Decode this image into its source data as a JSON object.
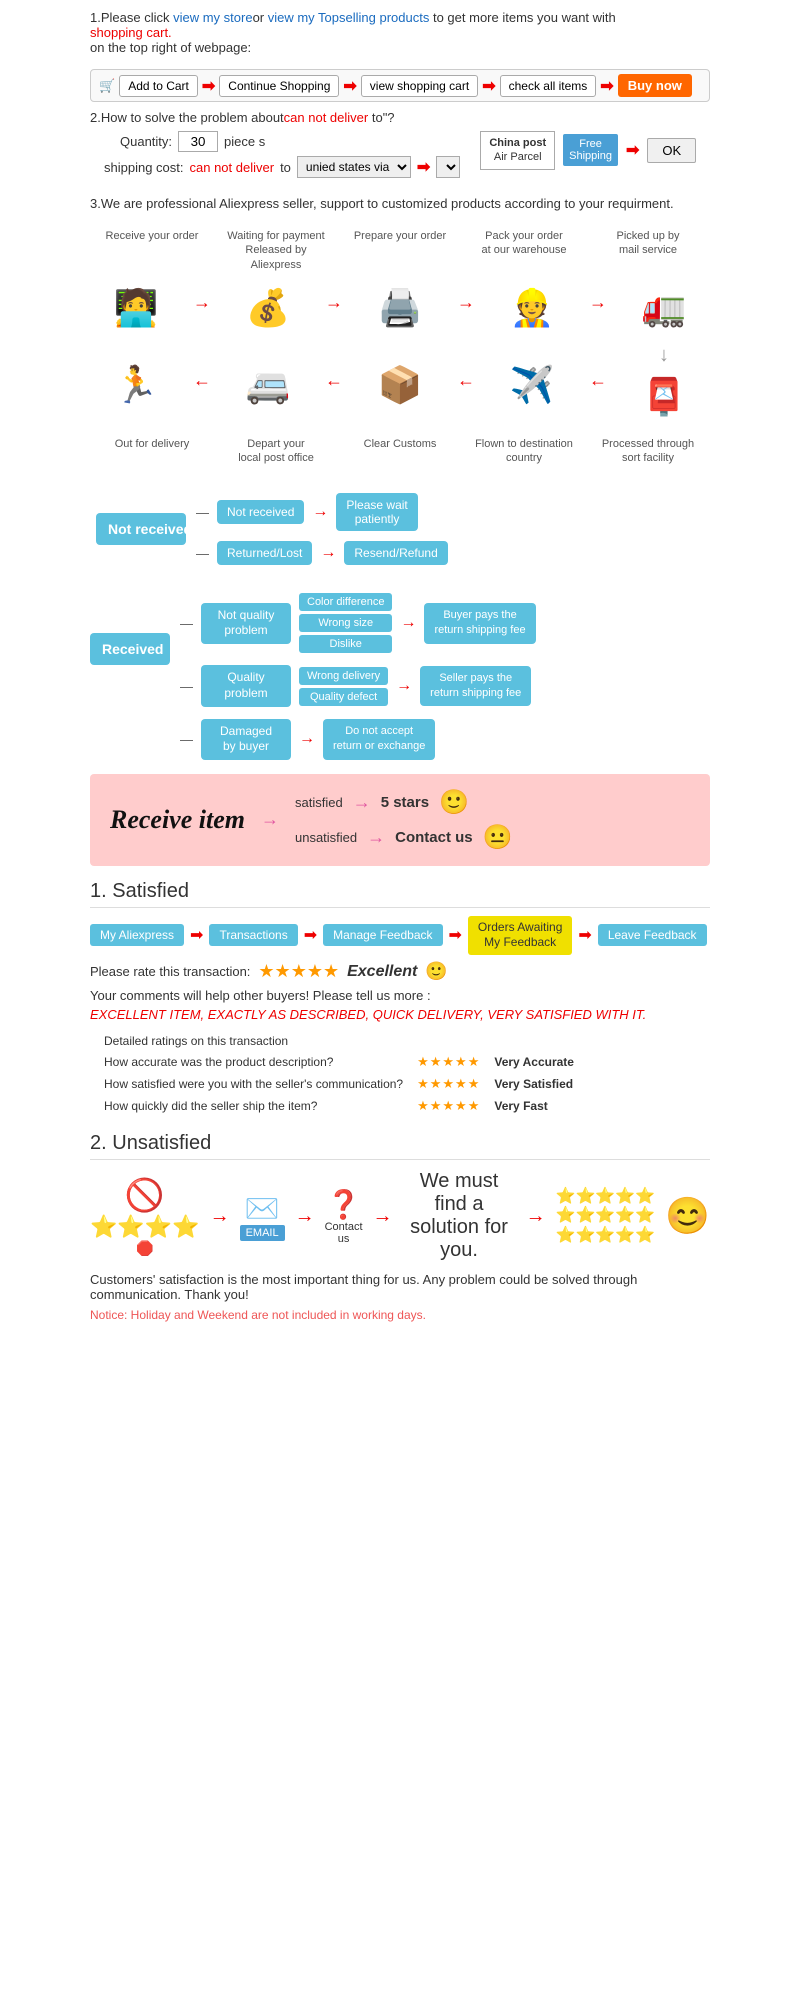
{
  "intro": {
    "line1_pre": "1.Please click ",
    "link1": "view my store",
    "line1_mid": "or ",
    "link2": "view my Topselling products",
    "line1_suf": " to get more items you want with",
    "line1b": "shopping cart.",
    "line2": "on the top right of webpage:"
  },
  "cart_bar": {
    "add": "Add to Cart",
    "continue": "Continue Shopping",
    "view": "view shopping cart",
    "check": "check all items",
    "buy": "Buy now",
    "cart_icon": "🛒"
  },
  "problem": {
    "title": "2.How to solve the problem about",
    "highlight": "can not deliver",
    "title_suf": " to\"?",
    "qty_label": "Quantity:",
    "qty_val": "30",
    "piece": "piece s",
    "ship_pre": "shipping cost:",
    "ship_red": "can not deliver",
    "ship_mid": " to ",
    "ship_sel": "unied states via",
    "china_post_line1": "China post",
    "china_post_line2": "Air Parcel",
    "free_ship": "Free\nShipping",
    "ok": "OK"
  },
  "professional": {
    "text": "3.We are professional Aliexpress seller, support to customized products according to your requirment."
  },
  "steps": {
    "row1": [
      {
        "label": "Receive your order",
        "icon": "🧑‍💻"
      },
      {
        "label": "Waiting for payment\nReleased by Aliexpress",
        "icon": "💰"
      },
      {
        "label": "Prepare your order",
        "icon": "🖨"
      },
      {
        "label": "Pack your order\nat our warehouse",
        "icon": "👷"
      },
      {
        "label": "Picked up by\nmail service",
        "icon": "🚛"
      }
    ],
    "row2": [
      {
        "label": "Out for delivery",
        "icon": "🏃"
      },
      {
        "label": "Depart your\nlocal post office",
        "icon": "🚐"
      },
      {
        "label": "Clear Customs",
        "icon": "📦"
      },
      {
        "label": "Flown to destination\ncountry",
        "icon": "✈️"
      },
      {
        "label": "Processed through\nsort facility",
        "icon": "📮"
      }
    ]
  },
  "not_received": {
    "title": "Not received",
    "sub1": "Not received",
    "out1": "Please wait\npatiently",
    "sub2": "Returned/Lost",
    "out2": "Resend/Refund"
  },
  "received": {
    "title": "Received",
    "issues": [
      {
        "label": "Not quality\nproblem",
        "subs": [
          "Color difference",
          "Wrong size",
          "Dislike"
        ],
        "payer": "Buyer pays the\nreturn shipping fee"
      },
      {
        "label": "Quality\nproblem",
        "subs": [
          "Wrong delivery",
          "Quality defect"
        ],
        "payer": "Seller pays the\nreturn shipping fee"
      },
      {
        "label": "Damaged\nby buyer",
        "subs": [
          "Do not accept\nreturn or exchange"
        ],
        "payer": ""
      }
    ]
  },
  "receive_item": {
    "title": "Receive item",
    "row1_label": "satisfied",
    "row1_outcome": "5 stars",
    "row1_emoji": "🙂",
    "row2_label": "unsatisfied",
    "row2_outcome": "Contact us",
    "row2_emoji": "😐"
  },
  "satisfied": {
    "section_num": "1.",
    "title": "Satisfied",
    "breadcrumbs": [
      "My Aliexpress",
      "Transactions",
      "Manage Feedback",
      "Orders Awaiting\nMy Feedback",
      "Leave Feedback"
    ],
    "rate_label": "Please rate this transaction:",
    "stars": "★★★★★",
    "excellent": "Excellent",
    "excellent_emoji": "🙂",
    "comment1": "Your comments will help other buyers! Please tell us more :",
    "comment2": "EXCELLENT ITEM, EXACTLY AS DESCRIBED, QUICK DELIVERY, VERY SATISFIED WITH IT.",
    "detail_title": "Detailed ratings on this transaction",
    "ratings": [
      {
        "q": "How accurate was the product description?",
        "stars": "★★★★★",
        "label": "Very Accurate"
      },
      {
        "q": "How satisfied were you with the seller's communication?",
        "stars": "★★★★★",
        "label": "Very Satisfied"
      },
      {
        "q": "How quickly did the seller ship the item?",
        "stars": "★★★★★",
        "label": "Very Fast"
      }
    ]
  },
  "unsatisfied": {
    "section_num": "2.",
    "title": "Unsatisfied",
    "steps": [
      {
        "icon": "🚫\n⭐⭐⭐⭐"
      },
      {
        "label": "→"
      },
      {
        "icon": "📧\nEMAIL\n✉"
      },
      {
        "label": "→"
      },
      {
        "icon": "❓"
      },
      {
        "label": "→"
      },
      {
        "icon": "⭐⭐⭐⭐⭐\n⭐⭐⭐⭐⭐\n⭐⭐⭐⭐⭐"
      }
    ],
    "contact_us": "Contact us",
    "find_sol": "We must find\na solution for\nyou.",
    "smiley": "😊",
    "note1": "Customers' satisfaction is the most important thing for us. Any problem could be solved through",
    "note2": "communication. Thank you!",
    "notice": "Notice: Holiday and Weekend are not included in working days."
  }
}
